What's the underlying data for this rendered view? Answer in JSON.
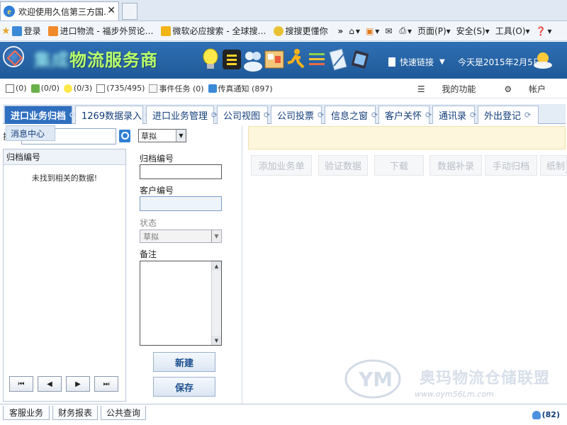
{
  "browser": {
    "tab_title": "欢迎使用久信第三方国…",
    "close_glyph": "✕",
    "favorites": [
      "登录",
      "进口物流 - 福步外贸论…",
      "微软必应搜索 - 全球搜…",
      "搜搜更懂你"
    ],
    "more": "»",
    "commands": [
      "页面(P)",
      "安全(S)",
      "工具(O)"
    ]
  },
  "header": {
    "brand_hidden": "集成",
    "brand": "物流服务商",
    "quick_links": "快速链接",
    "today": "今天是2015年2月5日"
  },
  "status_counts": {
    "mail": "(0)",
    "task": "(0/0)",
    "bulb": "(0/3)",
    "calendar": "(735/495)",
    "event_task": "事件任务 (0)",
    "fax": "传真通知 (897)",
    "my_functions": "我的功能",
    "account": "帐户"
  },
  "module_tabs": [
    "进口业务归档",
    "1269数据录入",
    "进口业务管理",
    "公司视图",
    "公司投票",
    "信息之窗",
    "客户关怀",
    "通讯录",
    "外出登记"
  ],
  "popup_tab": "消息中心",
  "left": {
    "search_label": "搜索",
    "header": "归档编号",
    "empty": "未找到相关的数据!",
    "pager": [
      "⏮",
      "◀",
      "▶",
      "⏭"
    ]
  },
  "form": {
    "top_status": "草拟",
    "archive_no_label": "归档编号",
    "customer_no_label": "客户编号",
    "status_label": "状态",
    "status_value": "草拟",
    "remark_label": "备注",
    "new_button": "新建",
    "save_button": "保存"
  },
  "actions": [
    "添加业务单",
    "验证数据",
    "下载",
    "数据补录",
    "手动归档",
    "纸制"
  ],
  "watermark": {
    "text": "奥玛物流仓储联盟",
    "url": "www.oym56Lm.com"
  },
  "footer": {
    "tabs": [
      "客服业务",
      "财务报表",
      "公共查询"
    ],
    "online": "(82)"
  }
}
